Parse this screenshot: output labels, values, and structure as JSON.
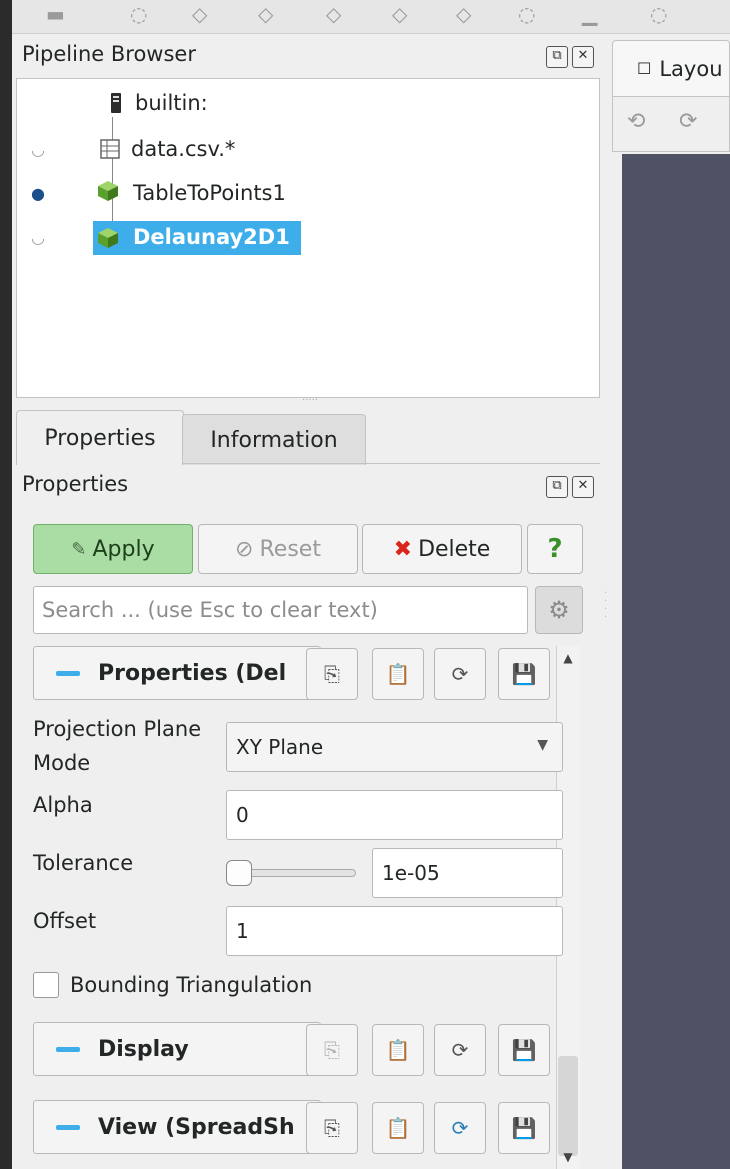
{
  "pipeline_browser": {
    "title": "Pipeline Browser",
    "items": [
      {
        "label": "builtin:",
        "icon": "server-icon",
        "eye": "none"
      },
      {
        "label": "data.csv.*",
        "icon": "table-icon",
        "eye": "hidden"
      },
      {
        "label": "TableToPoints1",
        "icon": "cube-icon",
        "eye": "visible"
      },
      {
        "label": "Delaunay2D1",
        "icon": "cube-icon",
        "eye": "hidden",
        "selected": true
      }
    ]
  },
  "tabs": [
    {
      "label": "Properties",
      "active": true
    },
    {
      "label": "Information",
      "active": false
    }
  ],
  "properties_panel": {
    "title": "Properties",
    "apply_label": "Apply",
    "reset_label": "Reset",
    "delete_label": "Delete",
    "help_label": "?",
    "search_placeholder": "Search ... (use Esc to clear text)",
    "sections": {
      "properties": "Properties (Del",
      "display": "Display",
      "view": "View (SpreadSh"
    },
    "fields": {
      "projection_plane_mode_label_1": "Projection Plane",
      "projection_plane_mode_label_2": "Mode",
      "projection_plane_mode_value": "XY Plane",
      "alpha_label": "Alpha",
      "alpha_value": "0",
      "tolerance_label": "Tolerance",
      "tolerance_value": "1e-05",
      "offset_label": "Offset",
      "offset_value": "1",
      "bounding_triangulation_label": "Bounding Triangulation",
      "bounding_triangulation_checked": false
    }
  },
  "layout": {
    "tab_label": "Layou"
  },
  "colors": {
    "accent": "#3daee9",
    "apply_bg": "#a9dda3",
    "view_bg": "#4f5164",
    "delete_icon": "#d9261c"
  }
}
